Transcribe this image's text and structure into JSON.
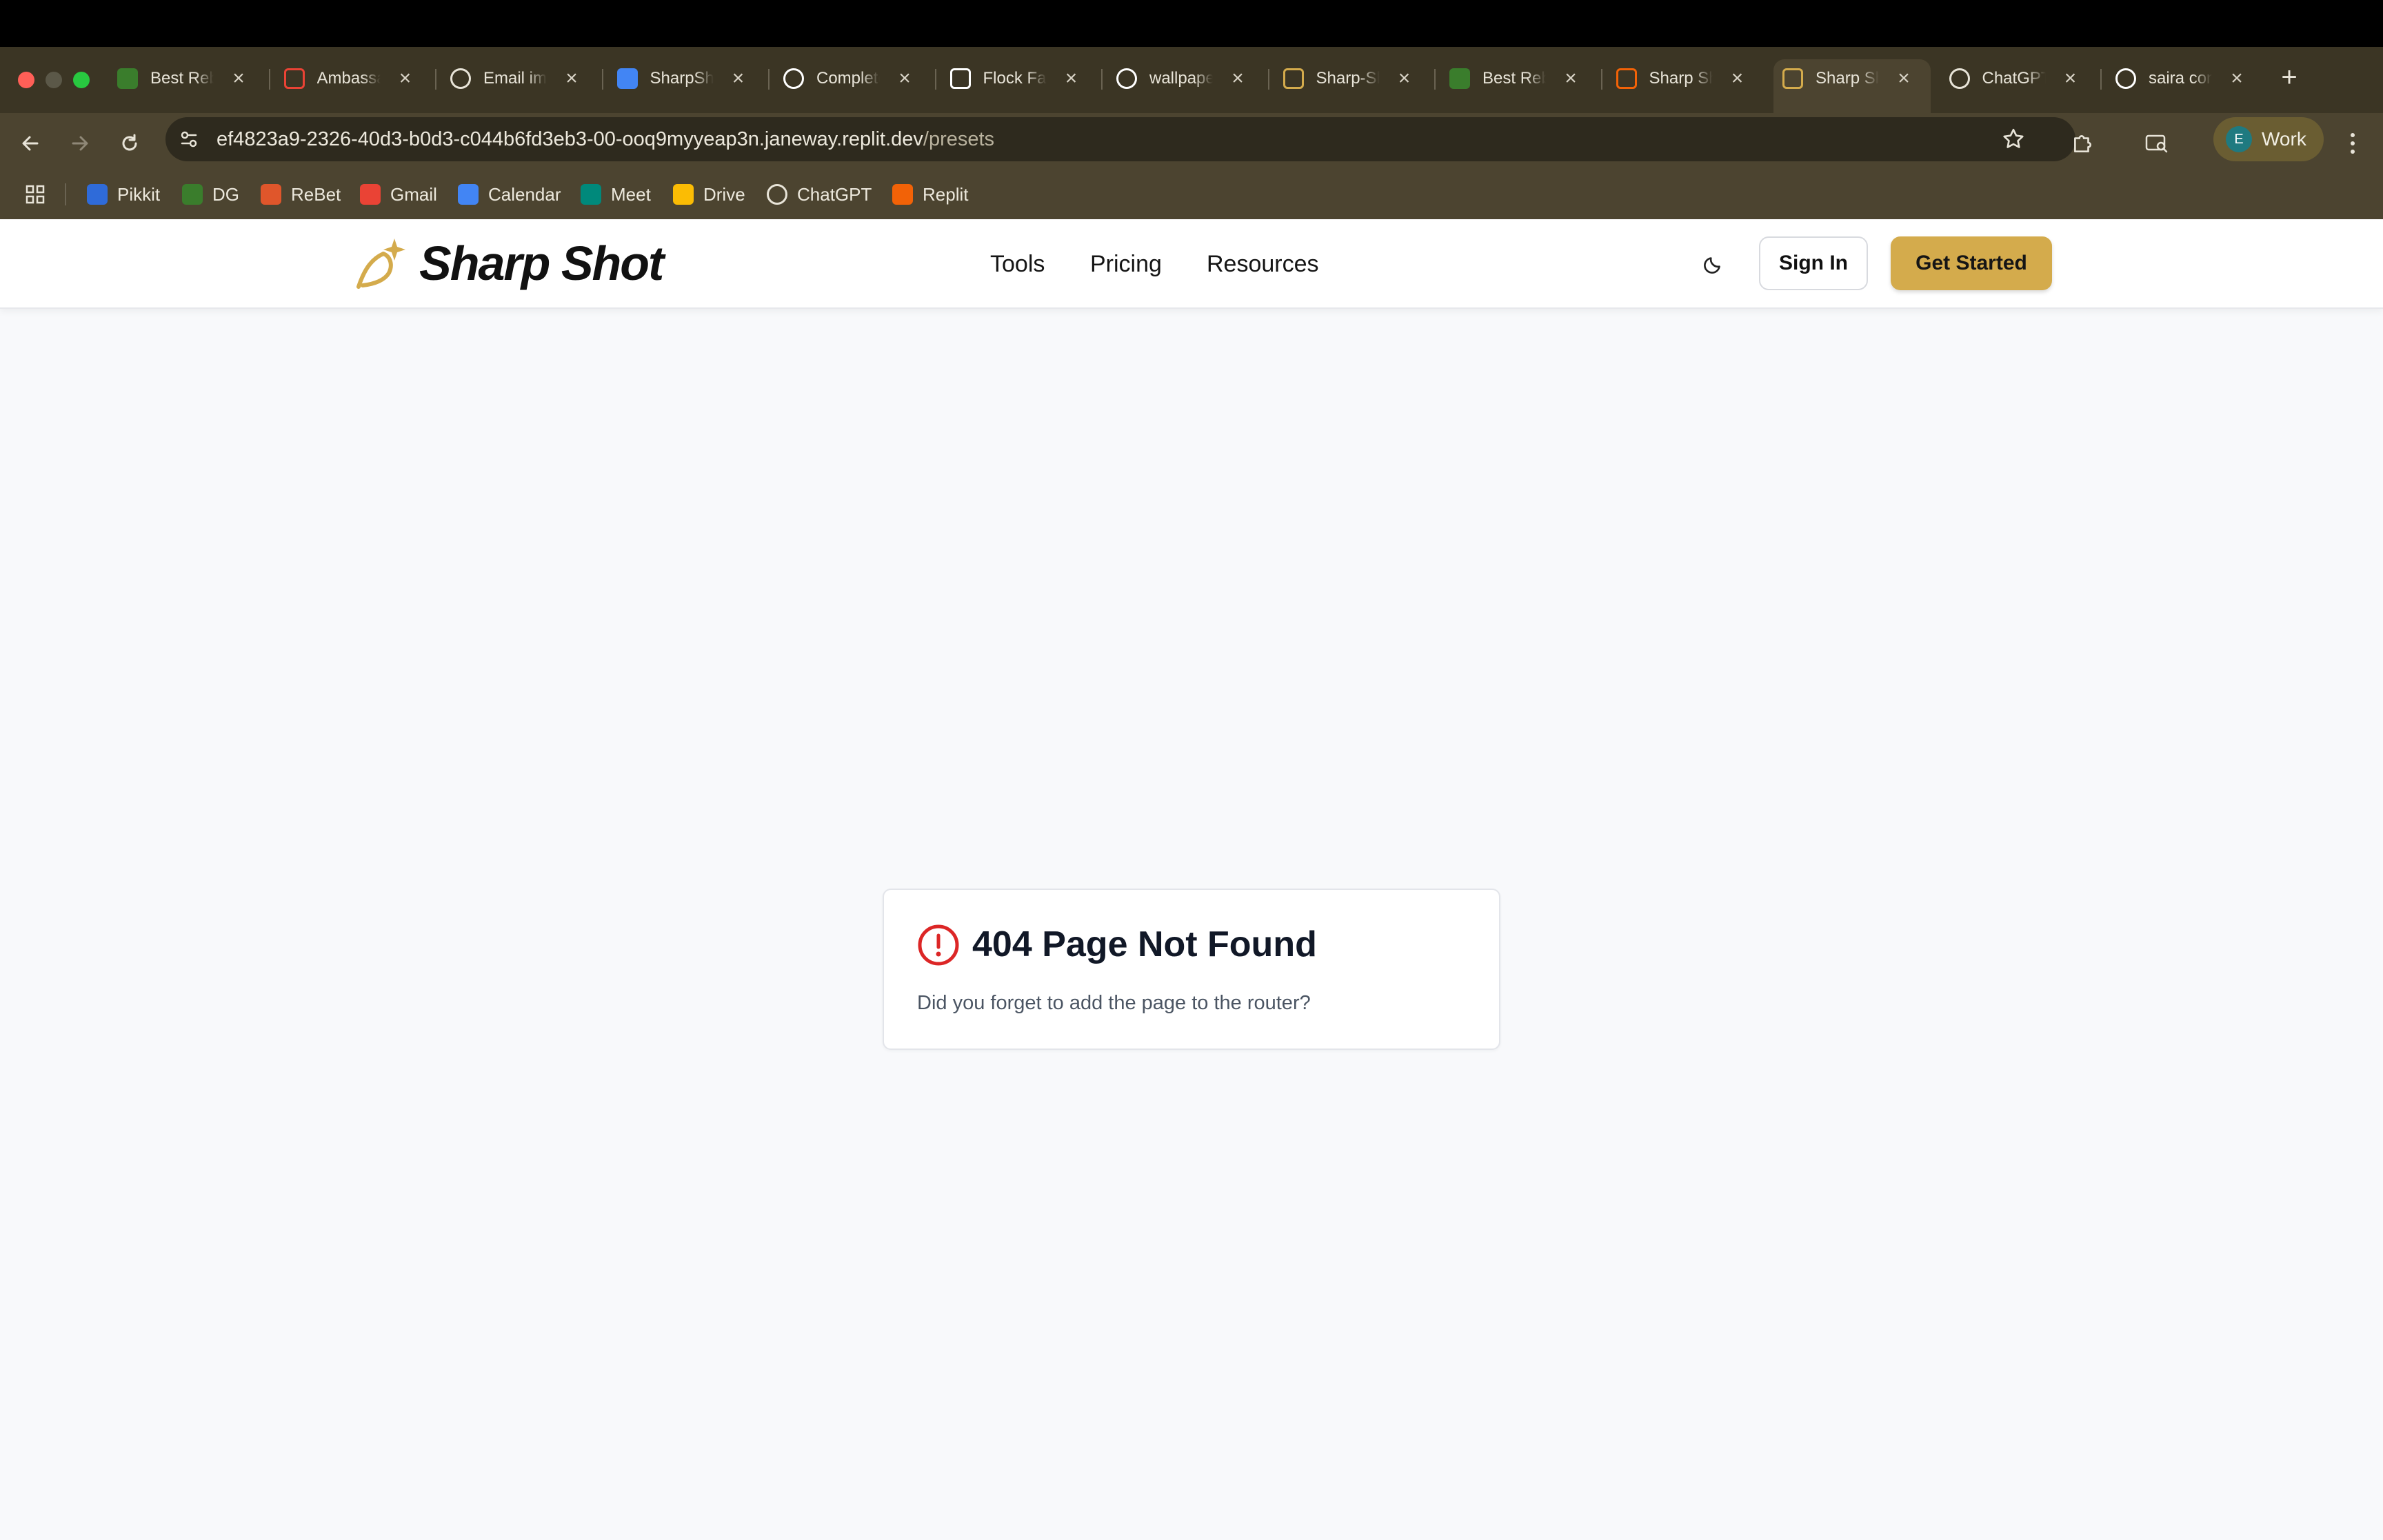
{
  "browser": {
    "tabs": [
      {
        "title": "Best Rebate",
        "icon": "link-icon",
        "color": "#3a7d2c"
      },
      {
        "title": "Ambassador",
        "icon": "gmail-icon",
        "color": "#ea4335"
      },
      {
        "title": "Email improve",
        "icon": "chatgpt-icon",
        "color": "#e8e4d8"
      },
      {
        "title": "SharpShot",
        "icon": "calendar-icon",
        "color": "#4285f4"
      },
      {
        "title": "Complete",
        "icon": "github-icon",
        "color": "#ffffff"
      },
      {
        "title": "Flock Farm",
        "icon": "bird-icon",
        "color": "#ffffff"
      },
      {
        "title": "wallpaper",
        "icon": "google-icon",
        "color": "#ffffff"
      },
      {
        "title": "Sharp-Shot",
        "icon": "sharpshot-icon",
        "color": "#d4ab4c"
      },
      {
        "title": "Best Rebate",
        "icon": "link-icon",
        "color": "#3a7d2c"
      },
      {
        "title": "Sharp Shot",
        "icon": "replit-icon",
        "color": "#f26207"
      },
      {
        "title": "Sharp Shot",
        "icon": "sharpshot-icon",
        "color": "#d4ab4c"
      },
      {
        "title": "ChatGPT",
        "icon": "chatgpt-icon",
        "color": "#e8e4d8"
      },
      {
        "title": "saira conde",
        "icon": "google-icon",
        "color": "#ffffff"
      }
    ],
    "active_tab_index": 10,
    "new_tab_label": "+",
    "address": {
      "host": "ef4823a9-2326-40d3-b0d3-c044b6fd3eb3-00-ooq9myyeap3n.janeway.replit.dev",
      "path": "/presets"
    },
    "profile": {
      "initial": "E",
      "name": "Work"
    },
    "bookmarks": [
      {
        "label": "Pikkit",
        "icon": "pikkit-icon",
        "color": "#2f6bd9"
      },
      {
        "label": "DG",
        "icon": "link-icon",
        "color": "#3a7d2c"
      },
      {
        "label": "ReBet",
        "icon": "rebet-icon",
        "color": "#e0562b"
      },
      {
        "label": "Gmail",
        "icon": "gmail-icon",
        "color": "#ea4335"
      },
      {
        "label": "Calendar",
        "icon": "calendar-icon",
        "color": "#4285f4"
      },
      {
        "label": "Meet",
        "icon": "meet-icon",
        "color": "#00897b"
      },
      {
        "label": "Drive",
        "icon": "drive-icon",
        "color": "#fbbc04"
      },
      {
        "label": "ChatGPT",
        "icon": "chatgpt-icon",
        "color": "#e8e4d8"
      },
      {
        "label": "Replit",
        "icon": "replit-icon",
        "color": "#f26207"
      }
    ]
  },
  "site": {
    "brand": "Sharp Shot",
    "nav": [
      "Tools",
      "Pricing",
      "Resources"
    ],
    "sign_in": "Sign In",
    "get_started": "Get Started",
    "accent_color": "#d4ab4c"
  },
  "error": {
    "title": "404 Page Not Found",
    "description": "Did you forget to add the page to the router?",
    "icon_color": "#dc2626"
  }
}
